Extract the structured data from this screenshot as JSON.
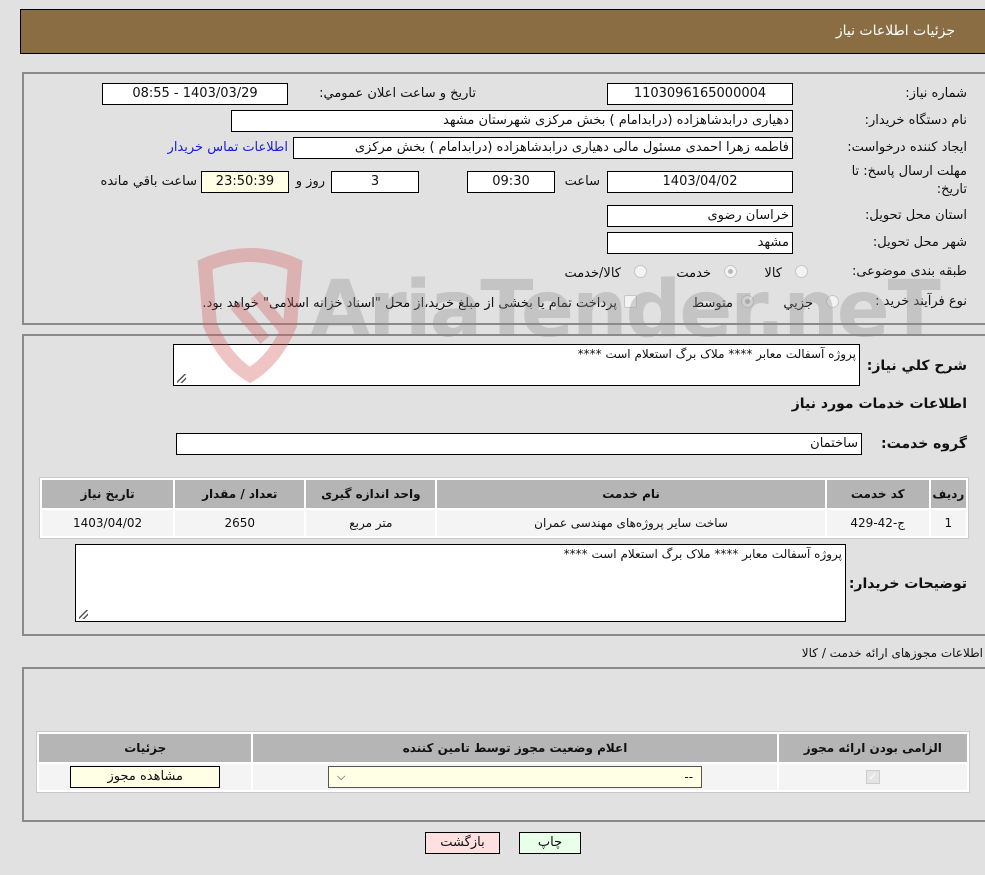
{
  "header": {
    "title": "جزئیات اطلاعات نیاز"
  },
  "fields": {
    "need_number": {
      "label": "شماره نیاز:",
      "value": "1103096165000004"
    },
    "announce": {
      "label": "تاریخ و ساعت اعلان عمومي:",
      "value": "1403/03/29 - 08:55"
    },
    "buyer_org": {
      "label": "نام دستگاه خریدار:",
      "value": "دهیاری درابدشاهزاده (درابدامام ) بخش مرکزی شهرستان مشهد"
    },
    "requester": {
      "label": "ایجاد کننده درخواست:",
      "value": "فاطمه زهرا احمدی مسئول مالی دهیاری درابدشاهزاده (درابدامام ) بخش مرکزی",
      "contact_link": "اطلاعات تماس خریدار"
    },
    "deadline": {
      "label_line1": "مهلت ارسال پاسخ: تا",
      "label_line2": "تاریخ:",
      "date": "1403/04/02",
      "time_label": "ساعت",
      "time": "09:30",
      "days": "3",
      "days_label": "روز و",
      "remaining": "23:50:39",
      "remaining_label": "ساعت باقي مانده"
    },
    "province": {
      "label": "استان محل تحویل:",
      "value": "خراسان رضوی"
    },
    "city": {
      "label": "شهر محل تحویل:",
      "value": "مشهد"
    },
    "category": {
      "label": "طبقه بندی موضوعی:",
      "options": [
        "کالا",
        "خدمت",
        "کالا/خدمت"
      ],
      "selected": "خدمت"
    },
    "process": {
      "label": "نوع فرآیند خرید :",
      "options": [
        "جزیي",
        "متوسط"
      ],
      "selected": "متوسط",
      "treasury_note": "پرداخت تمام یا بخشی از مبلغ خرید،از محل \"اسناد خزانه اسلامی\" خواهد بود."
    }
  },
  "description": {
    "label": "شرح کلي نیاز:",
    "value": "پروژه آسفالت معابر **** ملاک برگ استعلام است ****"
  },
  "services_section": {
    "title": "اطلاعات خدمات مورد نیاز",
    "group_label": "گروه خدمت:",
    "group_value": "ساختمان",
    "table": {
      "headers": [
        "ردیف",
        "کد خدمت",
        "نام خدمت",
        "واحد اندازه گیری",
        "تعداد / مقدار",
        "تاریخ نیاز"
      ],
      "rows": [
        [
          "1",
          "ج-42-429",
          "ساخت سایر پروژه‌های مهندسی عمران",
          "متر مربع",
          "2650",
          "1403/04/02"
        ]
      ]
    }
  },
  "buyer_notes": {
    "label": "توضیحات خریدار:",
    "value": "پروژه آسفالت معابر **** ملاک برگ استعلام است ****"
  },
  "permits": {
    "title": "اطلاعات مجوزهای ارائه خدمت / کالا",
    "headers": [
      "الزامی بودن ارائه مجوز",
      "اعلام وضعیت مجوز توسط تامین کننده",
      "جزئیات"
    ],
    "row": {
      "required_checked": true,
      "status_value": "--",
      "details_button": "مشاهده مجوز"
    }
  },
  "buttons": {
    "print": "چاپ",
    "back": "بازگشت"
  },
  "watermark": "AriaTender.neT",
  "colors": {
    "header_bg": "#8b6d43",
    "link": "#1c1cd8",
    "back_btn": "#ffe0e0",
    "print_btn": "#eaffea"
  }
}
